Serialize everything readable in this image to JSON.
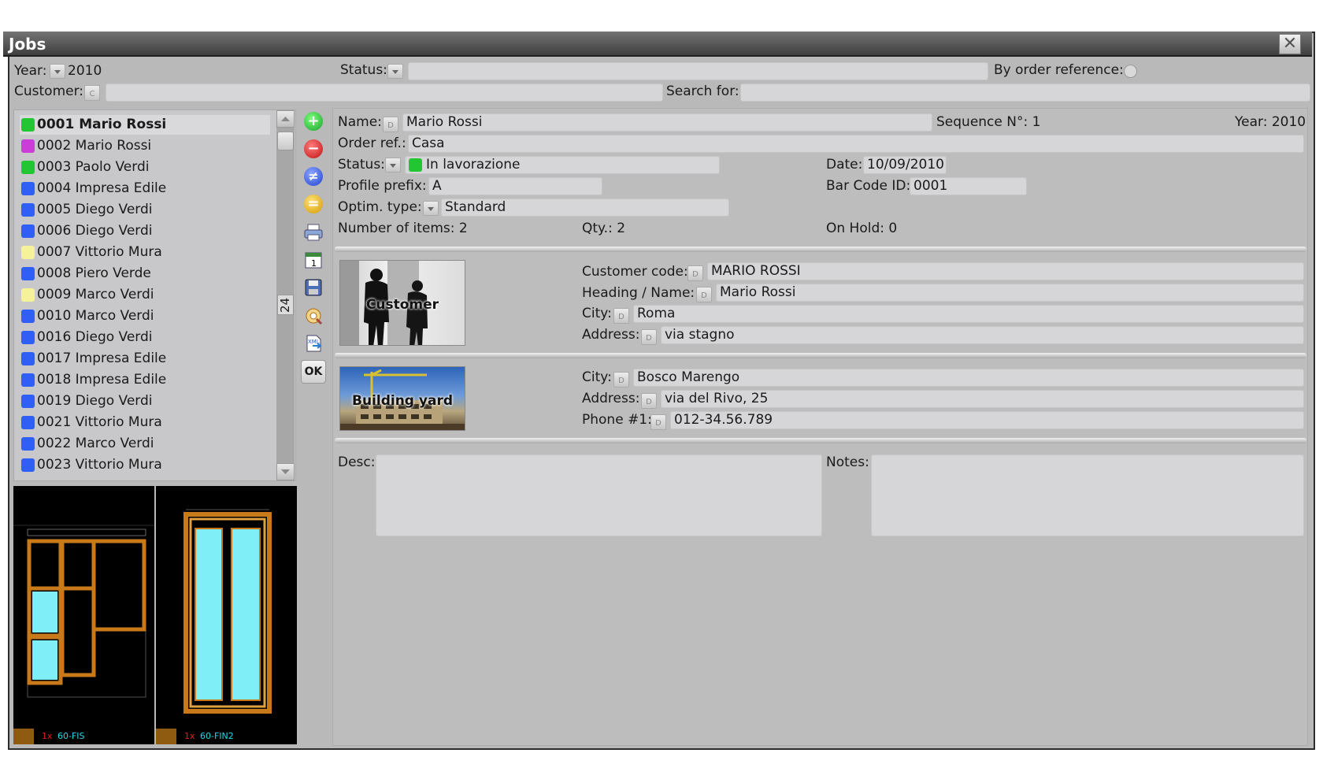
{
  "window": {
    "title": "Jobs",
    "close_icon": "close-icon"
  },
  "filters": {
    "year_label": "Year:",
    "year_value": "2010",
    "status_label": "Status:",
    "status_value": "",
    "by_order_ref_label": "By order reference:",
    "customer_label": "Customer:",
    "customer_btn": "C",
    "customer_value": "",
    "search_label": "Search for:",
    "search_value": ""
  },
  "jobs_list": {
    "scroll_count": "24",
    "items": [
      {
        "label": "0001 Mario Rossi",
        "color": "#22c532"
      },
      {
        "label": "0002 Mario Rossi",
        "color": "#cc3cd8"
      },
      {
        "label": "0003 Paolo Verdi",
        "color": "#22c532"
      },
      {
        "label": "0004 Impresa Edile",
        "color": "#2f5ff5"
      },
      {
        "label": "0005 Diego Verdi",
        "color": "#2f5ff5"
      },
      {
        "label": "0006 Diego Verdi",
        "color": "#2f5ff5"
      },
      {
        "label": "0007 Vittorio Mura",
        "color": "#f6f29a"
      },
      {
        "label": "0008 Piero Verde",
        "color": "#2f5ff5"
      },
      {
        "label": "0009 Marco Verdi",
        "color": "#f6f29a"
      },
      {
        "label": "0010 Marco Verdi",
        "color": "#2f5ff5"
      },
      {
        "label": "0016 Diego Verdi",
        "color": "#2f5ff5"
      },
      {
        "label": "0017 Impresa Edile",
        "color": "#2f5ff5"
      },
      {
        "label": "0018 Impresa Edile",
        "color": "#2f5ff5"
      },
      {
        "label": "0019 Diego Verdi",
        "color": "#2f5ff5"
      },
      {
        "label": "0021 Vittorio Mura",
        "color": "#2f5ff5"
      },
      {
        "label": "0022 Marco Verdi",
        "color": "#2f5ff5"
      },
      {
        "label": "0023 Vittorio Mura",
        "color": "#2f5ff5"
      }
    ]
  },
  "toolbar": {
    "ok_label": "OK"
  },
  "job": {
    "name_label": "Name:",
    "name_value": "Mario Rossi",
    "sequence": "Sequence N°: 1",
    "year": "Year: 2010",
    "order_ref_label": "Order ref.:",
    "order_ref_value": "Casa",
    "status_label": "Status:",
    "status_value": "In lavorazione",
    "status_color": "#22c532",
    "date_label": "Date:",
    "date_value": "10/09/2010",
    "profile_prefix_label": "Profile prefix:",
    "profile_prefix_value": "A",
    "barcode_label": "Bar Code ID:",
    "barcode_value": "0001",
    "optim_label": "Optim. type:",
    "optim_value": "Standard",
    "num_items": "Number of items: 2",
    "qty": "Qty.: 2",
    "on_hold": "On Hold: 0"
  },
  "customer": {
    "image_caption": "Customer",
    "code_label": "Customer code:",
    "code_value": "MARIO ROSSI",
    "heading_label": "Heading / Name:",
    "heading_value": "Mario Rossi",
    "city_label": "City:",
    "city_value": "Roma",
    "address_label": "Address:",
    "address_value": "via stagno"
  },
  "yard": {
    "image_caption": "Building yard",
    "city_label": "City:",
    "city_value": "Bosco Marengo",
    "address_label": "Address:",
    "address_value": "via del Rivo, 25",
    "phone_label": "Phone #1:",
    "phone_value": "012-34.56.789"
  },
  "notes": {
    "desc_label": "Desc:",
    "notes_label": "Notes:"
  },
  "previews": [
    {
      "qty": "1x",
      "code": "60-FIS"
    },
    {
      "qty": "1x",
      "code": "60-FIN2"
    }
  ],
  "d_button": "D"
}
